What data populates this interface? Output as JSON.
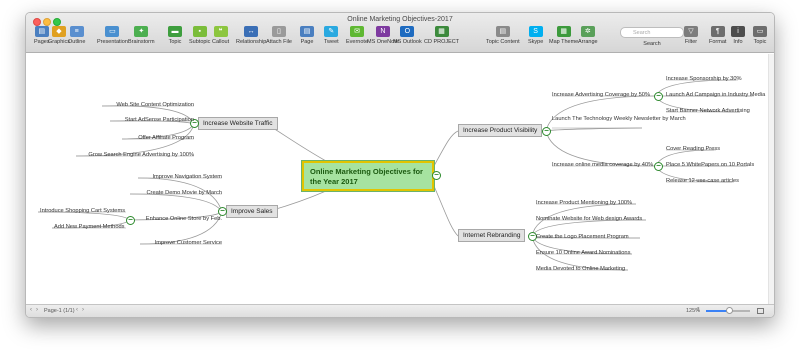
{
  "window": {
    "title": "Online Marketing Objectives-2017"
  },
  "toolbar": [
    {
      "label": "Pages",
      "icon": "pages-icon",
      "color": "#4a7fc0",
      "glyph": "▤"
    },
    {
      "label": "Graphics",
      "icon": "graphics-icon",
      "color": "#e0a020",
      "glyph": "◆"
    },
    {
      "label": "Outline",
      "icon": "outline-icon",
      "color": "#5a8fcf",
      "glyph": "≡"
    },
    {
      "label": "Presentation",
      "icon": "presentation-icon",
      "color": "#4a90d0",
      "glyph": "▭"
    },
    {
      "label": "Brainstorm",
      "icon": "brainstorm-icon",
      "color": "#4caf50",
      "glyph": "✦"
    },
    {
      "label": "Topic",
      "icon": "topic-icon",
      "color": "#3e9e3e",
      "glyph": "▬"
    },
    {
      "label": "Subtopic",
      "icon": "subtopic-icon",
      "color": "#7bbd3a",
      "glyph": "▪"
    },
    {
      "label": "Callout",
      "icon": "callout-icon",
      "color": "#8dc63f",
      "glyph": "❝"
    },
    {
      "label": "Relationship",
      "icon": "relationship-icon",
      "color": "#3b6fb6",
      "glyph": "↔"
    },
    {
      "label": "Attach File",
      "icon": "attach-file-icon",
      "color": "#9a9a9a",
      "glyph": "▯"
    },
    {
      "label": "Page",
      "icon": "page-icon",
      "color": "#4a7fc0",
      "glyph": "▤"
    },
    {
      "label": "Tweet",
      "icon": "tweet-icon",
      "color": "#2aa9e0",
      "glyph": "✎"
    },
    {
      "label": "Evernote",
      "icon": "evernote-icon",
      "color": "#5fb832",
      "glyph": "✉"
    },
    {
      "label": "MS OneNote",
      "icon": "onenote-icon",
      "color": "#7e3aa0",
      "glyph": "N"
    },
    {
      "label": "MS Outlook",
      "icon": "outlook-icon",
      "color": "#1e6bc0",
      "glyph": "O"
    },
    {
      "label": "CD PROJECT",
      "icon": "cd-project-icon",
      "color": "#3c8a3c",
      "glyph": "▦"
    },
    {
      "label": "Topic Content",
      "icon": "topic-content-icon",
      "color": "#8a8a8a",
      "glyph": "▤"
    },
    {
      "label": "Skype",
      "icon": "skype-icon",
      "color": "#00aff0",
      "glyph": "S"
    },
    {
      "label": "Map Theme",
      "icon": "map-theme-icon",
      "color": "#3c9a3c",
      "glyph": "▦"
    },
    {
      "label": "Arrange",
      "icon": "arrange-icon",
      "color": "#5aa05a",
      "glyph": "✲"
    },
    {
      "label": "Filter",
      "icon": "filter-icon",
      "color": "#7d7d7d",
      "glyph": "▽"
    },
    {
      "label": "Format",
      "icon": "format-icon",
      "color": "#6d6d6d",
      "glyph": "¶"
    },
    {
      "label": "Info",
      "icon": "info-icon",
      "color": "#4d4d4d",
      "glyph": "i"
    },
    {
      "label": "Topic",
      "icon": "topic-panel-icon",
      "color": "#6d6d6d",
      "glyph": "▭"
    }
  ],
  "search": {
    "placeholder": "Search",
    "label": "Search"
  },
  "map": {
    "central": "Online Marketing Objectives for the Year 2017",
    "branches": {
      "traffic": {
        "label": "Increase Website Traffic",
        "leaves": [
          "Web Site Content Optimization",
          "Start AdSense Participation",
          "Offer Affiliate Program",
          "Grow Search Engine Advertising by 100%"
        ]
      },
      "sales": {
        "label": "Improve  Sales",
        "leaves": [
          "Improve Navigation System",
          "Create Demo Movie by March",
          "Enhance Online Store by Feb.",
          "Improve Customer Service"
        ],
        "subleaves": [
          "Introduce Shopping Cart Systems",
          "Add New Payment Methods"
        ]
      },
      "visibility": {
        "label": "Increase Product Visibility",
        "leaves": [
          "Increase Advertising Coverage by 50%",
          "Launch The Technology Weekly Newsletter by March",
          "Increase online media coverage by 40%"
        ],
        "subleaves_ad": [
          "Increase  Sponsorship by 30%",
          "Launch Ad Campaign in Industry Media",
          "Start Banner Network Advertising"
        ],
        "subleaves_media": [
          "Cover Reading Press",
          "Place 5 WhitePapers on 10 Portals",
          "Release 12 use-case articles"
        ]
      },
      "rebranding": {
        "label": "Internet Rebranding",
        "leaves": [
          "Increase Product Mentioning by 100%",
          "Nominate Website for Web design Awards",
          "Create the Logo Placement Program",
          "Ensure 10 Online Award Nominations",
          "Media Devoted to Online Marketing"
        ]
      }
    }
  },
  "status": {
    "page": "Page-1 (1/1)",
    "zoom": "125%"
  }
}
